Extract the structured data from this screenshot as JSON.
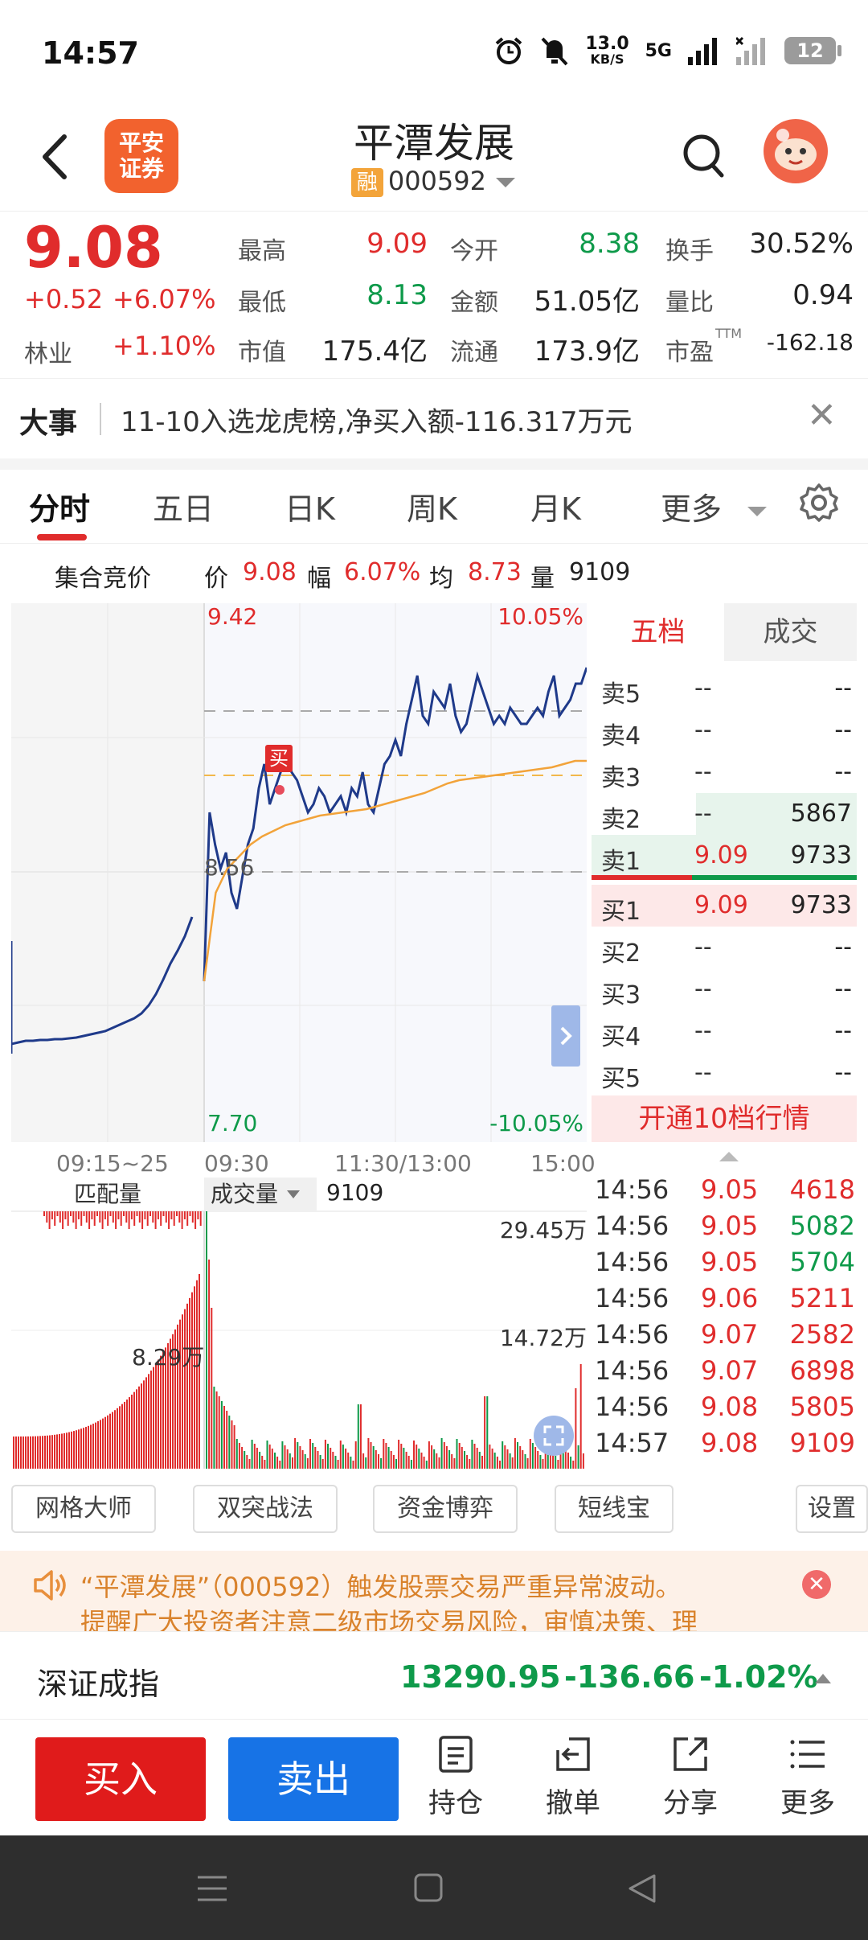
{
  "status": {
    "time": "14:57",
    "net_speed_top": "13.0",
    "net_speed_unit": "KB/S",
    "network": "5G",
    "battery": "12"
  },
  "header": {
    "broker_logo_text": "平安证券",
    "title": "平潭发展",
    "margin_tag": "融",
    "code": "000592"
  },
  "quote": {
    "price": "9.08",
    "change": "+0.52",
    "change_pct": "+6.07%",
    "sector_label": "林业",
    "sector_pct": "+1.10%",
    "items": [
      {
        "label": "最高",
        "value": "9.09",
        "color": "red"
      },
      {
        "label": "今开",
        "value": "8.38",
        "color": "green"
      },
      {
        "label": "换手",
        "value": "30.52%",
        "color": "dark"
      },
      {
        "label": "最低",
        "value": "8.13",
        "color": "green"
      },
      {
        "label": "金额",
        "value": "51.05亿",
        "color": "dark"
      },
      {
        "label": "量比",
        "value": "0.94",
        "color": "dark"
      },
      {
        "label": "市值",
        "value": "175.4亿",
        "color": "dark"
      },
      {
        "label": "流通",
        "value": "173.9亿",
        "color": "dark"
      },
      {
        "label": "市盈",
        "value": "-162.18",
        "color": "dark",
        "sup": "TTM"
      }
    ]
  },
  "news": {
    "tag": "大事",
    "text": "11-10入选龙虎榜,净买入额-116.317万元"
  },
  "tabs": [
    "分时",
    "五日",
    "日K",
    "周K",
    "月K",
    "更多"
  ],
  "summary": {
    "auction_label": "集合竞价",
    "price_label": "价",
    "price": "9.08",
    "pct_label": "幅",
    "pct": "6.07%",
    "avg_label": "均",
    "avg": "8.73",
    "vol_label": "量",
    "vol": "9109"
  },
  "chart": {
    "top_price": "9.42",
    "top_pct": "10.05%",
    "mid_price": "8.56",
    "bottom_price": "7.70",
    "bottom_pct": "-10.05%",
    "buy_marker": "买"
  },
  "time_axis": [
    "09:15~25",
    "09:30",
    "11:30/13:00",
    "15:00"
  ],
  "volume": {
    "match_label": "匹配量",
    "vol_select": "成交量",
    "vol_value": "9109",
    "top_label": "29.45万",
    "mid_label": "14.72万",
    "auction_label": "8.29万"
  },
  "book": {
    "tabs": [
      "五档",
      "成交"
    ],
    "asks": [
      {
        "label": "卖5",
        "price": "--",
        "vol": "--"
      },
      {
        "label": "卖4",
        "price": "--",
        "vol": "--"
      },
      {
        "label": "卖3",
        "price": "--",
        "vol": "--"
      },
      {
        "label": "卖2",
        "price": "--",
        "vol": "5867"
      },
      {
        "label": "卖1",
        "price": "9.09",
        "vol": "9733"
      }
    ],
    "bids": [
      {
        "label": "买1",
        "price": "9.09",
        "vol": "9733"
      },
      {
        "label": "买2",
        "price": "--",
        "vol": "--"
      },
      {
        "label": "买3",
        "price": "--",
        "vol": "--"
      },
      {
        "label": "买4",
        "price": "--",
        "vol": "--"
      },
      {
        "label": "买5",
        "price": "--",
        "vol": "--"
      }
    ],
    "open10": "开通10档行情"
  },
  "trades": [
    {
      "time": "14:56",
      "price": "9.05",
      "vol": "4618",
      "dir": "red"
    },
    {
      "time": "14:56",
      "price": "9.05",
      "vol": "5082",
      "dir": "green"
    },
    {
      "time": "14:56",
      "price": "9.05",
      "vol": "5704",
      "dir": "green"
    },
    {
      "time": "14:56",
      "price": "9.06",
      "vol": "5211",
      "dir": "red"
    },
    {
      "time": "14:56",
      "price": "9.07",
      "vol": "2582",
      "dir": "red"
    },
    {
      "time": "14:56",
      "price": "9.07",
      "vol": "6898",
      "dir": "red"
    },
    {
      "time": "14:56",
      "price": "9.08",
      "vol": "5805",
      "dir": "red"
    },
    {
      "time": "14:57",
      "price": "9.08",
      "vol": "9109",
      "dir": "red"
    }
  ],
  "tools": [
    "网格大师",
    "双突战法",
    "资金博弈",
    "短线宝",
    "设置"
  ],
  "warning": {
    "line1": "“平潭发展”（000592）触发股票交易严重异常波动。",
    "line2": "提醒广大投资者注意二级市场交易风险，审慎决策、理"
  },
  "index": {
    "name": "深证成指",
    "value": "13290.95",
    "change": "-136.66",
    "pct": "-1.02%"
  },
  "actions": {
    "buy": "买入",
    "sell": "卖出",
    "items": [
      "持仓",
      "撤单",
      "分享",
      "更多"
    ]
  },
  "colors": {
    "up": "#e02c2c",
    "down": "#0e9a4a",
    "price_line": "#1f3a8a",
    "avg_line": "#f2a33a"
  }
}
